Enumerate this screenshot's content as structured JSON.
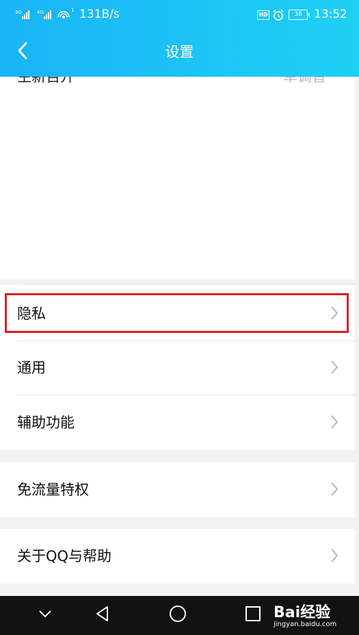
{
  "status_bar": {
    "signal_1": "3G",
    "signal_2": "4G",
    "hotspot_count": "1",
    "speed": "131B/s",
    "hd": "HD",
    "battery": "38",
    "time": "13:52"
  },
  "header": {
    "title": "设置",
    "back_icon": "chevron-left-icon"
  },
  "top_partial": {
    "left_text": "主新百开",
    "right_text": "单调音"
  },
  "menu": [
    {
      "label": "隐私",
      "icon": "chevron-right-icon"
    },
    {
      "label": "通用",
      "icon": "chevron-right-icon"
    },
    {
      "label": "辅助功能",
      "icon": "chevron-right-icon"
    },
    {
      "label": "免流量特权",
      "icon": "chevron-right-icon"
    },
    {
      "label": "关于QQ与帮助",
      "icon": "chevron-right-icon"
    }
  ],
  "highlight_color": "#e01c22",
  "bottom_nav": {
    "icons": [
      "chevron-down-icon",
      "back-triangle-icon",
      "home-circle-icon",
      "recents-square-icon"
    ]
  },
  "watermark": {
    "brand": "Bai经验",
    "url": "jingyan.baidu.com"
  }
}
